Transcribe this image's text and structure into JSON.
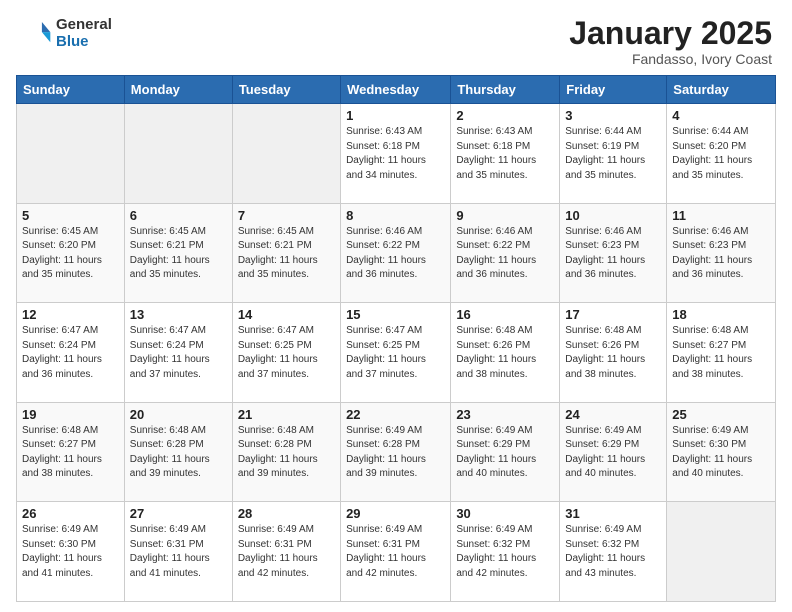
{
  "header": {
    "logo_general": "General",
    "logo_blue": "Blue",
    "month_title": "January 2025",
    "location": "Fandasso, Ivory Coast"
  },
  "weekdays": [
    "Sunday",
    "Monday",
    "Tuesday",
    "Wednesday",
    "Thursday",
    "Friday",
    "Saturday"
  ],
  "weeks": [
    [
      {
        "day": "",
        "info": ""
      },
      {
        "day": "",
        "info": ""
      },
      {
        "day": "",
        "info": ""
      },
      {
        "day": "1",
        "info": "Sunrise: 6:43 AM\nSunset: 6:18 PM\nDaylight: 11 hours\nand 34 minutes."
      },
      {
        "day": "2",
        "info": "Sunrise: 6:43 AM\nSunset: 6:18 PM\nDaylight: 11 hours\nand 35 minutes."
      },
      {
        "day": "3",
        "info": "Sunrise: 6:44 AM\nSunset: 6:19 PM\nDaylight: 11 hours\nand 35 minutes."
      },
      {
        "day": "4",
        "info": "Sunrise: 6:44 AM\nSunset: 6:20 PM\nDaylight: 11 hours\nand 35 minutes."
      }
    ],
    [
      {
        "day": "5",
        "info": "Sunrise: 6:45 AM\nSunset: 6:20 PM\nDaylight: 11 hours\nand 35 minutes."
      },
      {
        "day": "6",
        "info": "Sunrise: 6:45 AM\nSunset: 6:21 PM\nDaylight: 11 hours\nand 35 minutes."
      },
      {
        "day": "7",
        "info": "Sunrise: 6:45 AM\nSunset: 6:21 PM\nDaylight: 11 hours\nand 35 minutes."
      },
      {
        "day": "8",
        "info": "Sunrise: 6:46 AM\nSunset: 6:22 PM\nDaylight: 11 hours\nand 36 minutes."
      },
      {
        "day": "9",
        "info": "Sunrise: 6:46 AM\nSunset: 6:22 PM\nDaylight: 11 hours\nand 36 minutes."
      },
      {
        "day": "10",
        "info": "Sunrise: 6:46 AM\nSunset: 6:23 PM\nDaylight: 11 hours\nand 36 minutes."
      },
      {
        "day": "11",
        "info": "Sunrise: 6:46 AM\nSunset: 6:23 PM\nDaylight: 11 hours\nand 36 minutes."
      }
    ],
    [
      {
        "day": "12",
        "info": "Sunrise: 6:47 AM\nSunset: 6:24 PM\nDaylight: 11 hours\nand 36 minutes."
      },
      {
        "day": "13",
        "info": "Sunrise: 6:47 AM\nSunset: 6:24 PM\nDaylight: 11 hours\nand 37 minutes."
      },
      {
        "day": "14",
        "info": "Sunrise: 6:47 AM\nSunset: 6:25 PM\nDaylight: 11 hours\nand 37 minutes."
      },
      {
        "day": "15",
        "info": "Sunrise: 6:47 AM\nSunset: 6:25 PM\nDaylight: 11 hours\nand 37 minutes."
      },
      {
        "day": "16",
        "info": "Sunrise: 6:48 AM\nSunset: 6:26 PM\nDaylight: 11 hours\nand 38 minutes."
      },
      {
        "day": "17",
        "info": "Sunrise: 6:48 AM\nSunset: 6:26 PM\nDaylight: 11 hours\nand 38 minutes."
      },
      {
        "day": "18",
        "info": "Sunrise: 6:48 AM\nSunset: 6:27 PM\nDaylight: 11 hours\nand 38 minutes."
      }
    ],
    [
      {
        "day": "19",
        "info": "Sunrise: 6:48 AM\nSunset: 6:27 PM\nDaylight: 11 hours\nand 38 minutes."
      },
      {
        "day": "20",
        "info": "Sunrise: 6:48 AM\nSunset: 6:28 PM\nDaylight: 11 hours\nand 39 minutes."
      },
      {
        "day": "21",
        "info": "Sunrise: 6:48 AM\nSunset: 6:28 PM\nDaylight: 11 hours\nand 39 minutes."
      },
      {
        "day": "22",
        "info": "Sunrise: 6:49 AM\nSunset: 6:28 PM\nDaylight: 11 hours\nand 39 minutes."
      },
      {
        "day": "23",
        "info": "Sunrise: 6:49 AM\nSunset: 6:29 PM\nDaylight: 11 hours\nand 40 minutes."
      },
      {
        "day": "24",
        "info": "Sunrise: 6:49 AM\nSunset: 6:29 PM\nDaylight: 11 hours\nand 40 minutes."
      },
      {
        "day": "25",
        "info": "Sunrise: 6:49 AM\nSunset: 6:30 PM\nDaylight: 11 hours\nand 40 minutes."
      }
    ],
    [
      {
        "day": "26",
        "info": "Sunrise: 6:49 AM\nSunset: 6:30 PM\nDaylight: 11 hours\nand 41 minutes."
      },
      {
        "day": "27",
        "info": "Sunrise: 6:49 AM\nSunset: 6:31 PM\nDaylight: 11 hours\nand 41 minutes."
      },
      {
        "day": "28",
        "info": "Sunrise: 6:49 AM\nSunset: 6:31 PM\nDaylight: 11 hours\nand 42 minutes."
      },
      {
        "day": "29",
        "info": "Sunrise: 6:49 AM\nSunset: 6:31 PM\nDaylight: 11 hours\nand 42 minutes."
      },
      {
        "day": "30",
        "info": "Sunrise: 6:49 AM\nSunset: 6:32 PM\nDaylight: 11 hours\nand 42 minutes."
      },
      {
        "day": "31",
        "info": "Sunrise: 6:49 AM\nSunset: 6:32 PM\nDaylight: 11 hours\nand 43 minutes."
      },
      {
        "day": "",
        "info": ""
      }
    ]
  ]
}
